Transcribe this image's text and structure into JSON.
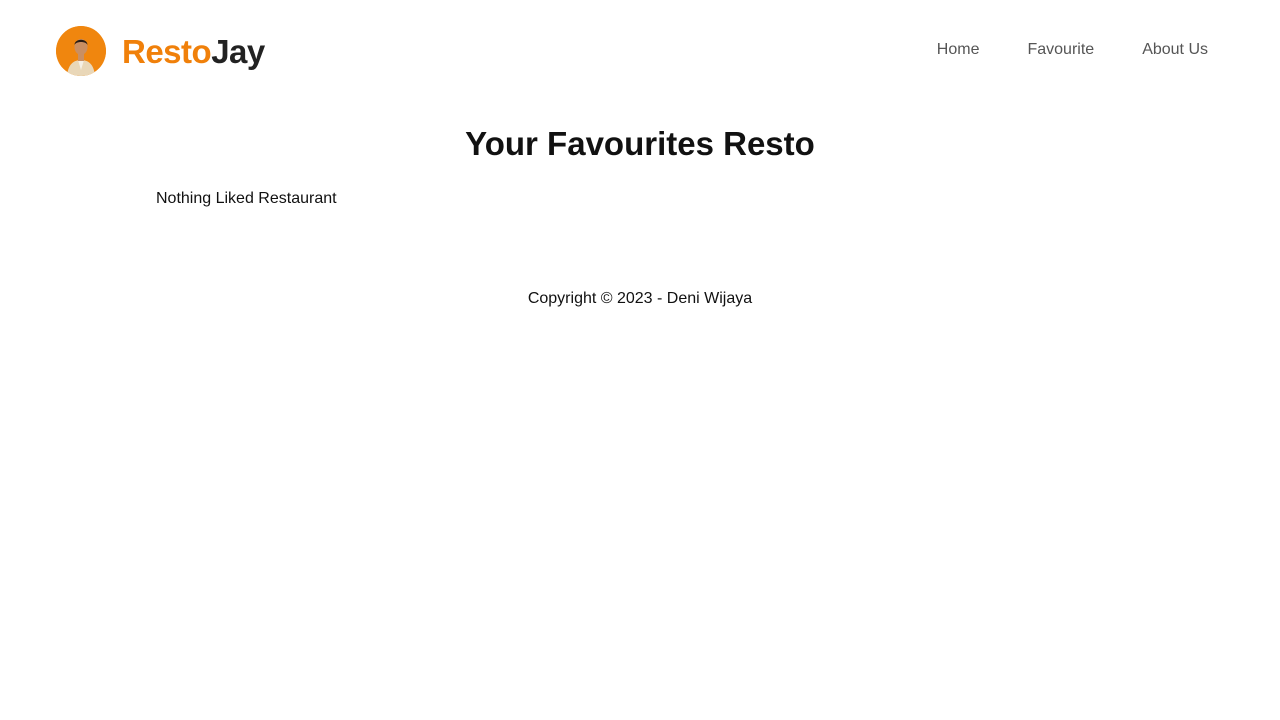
{
  "brand": {
    "name_part1": "Resto",
    "name_part2": "Jay",
    "accent_color": "#f0800a",
    "avatar_icon": "person-avatar-icon"
  },
  "nav": {
    "items": [
      {
        "label": "Home"
      },
      {
        "label": "Favourite"
      },
      {
        "label": "About Us"
      }
    ]
  },
  "main": {
    "title": "Your Favourites Resto",
    "empty_message": "Nothing Liked Restaurant"
  },
  "footer": {
    "copyright": "Copyright © 2023 - Deni Wijaya"
  }
}
